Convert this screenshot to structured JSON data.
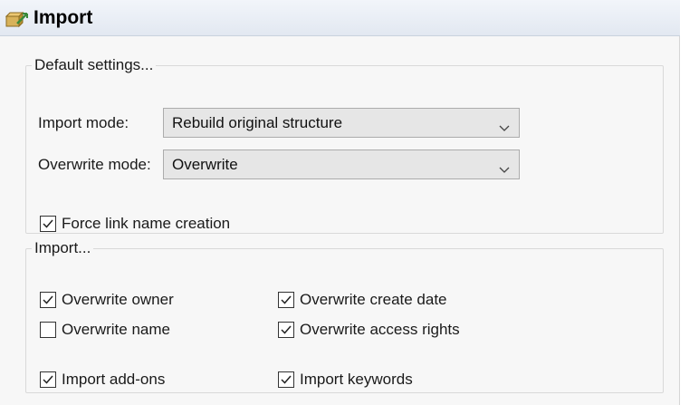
{
  "header": {
    "title": "Import",
    "icon": "import-icon"
  },
  "default_settings": {
    "legend": "Default settings...",
    "import_mode": {
      "label": "Import mode:",
      "value": "Rebuild original structure"
    },
    "overwrite_mode": {
      "label": "Overwrite mode:",
      "value": "Overwrite"
    },
    "force_link": {
      "label": "Force link name creation",
      "checked": true
    }
  },
  "import_group": {
    "legend": "Import...",
    "overwrite_owner": {
      "label": "Overwrite owner",
      "checked": true
    },
    "overwrite_create_date": {
      "label": "Overwrite create date",
      "checked": true
    },
    "overwrite_name": {
      "label": "Overwrite name",
      "checked": false
    },
    "overwrite_access_rights": {
      "label": "Overwrite access rights",
      "checked": true
    },
    "import_addons": {
      "label": "Import add-ons",
      "checked": true
    },
    "import_keywords": {
      "label": "Import keywords",
      "checked": true
    }
  },
  "colors": {
    "title_bar": "#e2e8f1",
    "combo_bg": "#e6e6e6",
    "panel_bg": "#f7f7f7"
  }
}
